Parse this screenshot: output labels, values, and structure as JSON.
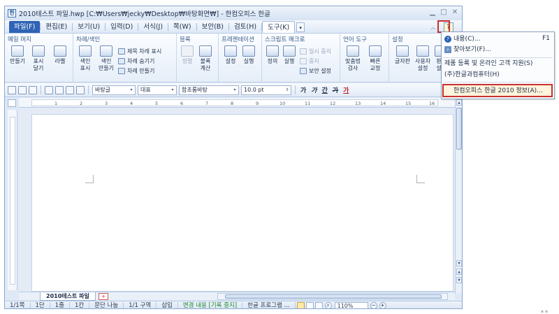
{
  "window": {
    "title": "2010테스트 파일.hwp [C:₩Users₩jecky₩Desktop₩바탕화면₩] - 한컴오피스 한글",
    "icon_label": "한"
  },
  "menus": [
    {
      "label": "파일(F)"
    },
    {
      "label": "편집(E)"
    },
    {
      "label": "보기(U)"
    },
    {
      "label": "입력(D)"
    },
    {
      "label": "서식(J)"
    },
    {
      "label": "쪽(W)"
    },
    {
      "label": "보안(B)"
    },
    {
      "label": "검토(H)"
    },
    {
      "label": "도구(K)"
    }
  ],
  "help_button": "?",
  "ribbon": {
    "groups": {
      "mail_merge": "메일 머지",
      "toc": "차례/색인",
      "block": "블록",
      "presentation": "프레젠테이션",
      "script": "스크립트 매크로",
      "language": "언어 도구",
      "settings": "설정"
    },
    "buttons": {
      "merge_make_1": "만들기",
      "merge_show_1": "표시",
      "merge_show_2": "달기",
      "label": "라벨",
      "index_show_1": "색인",
      "index_show_2": "표시",
      "index_make_1": "색인",
      "index_make_2": "만들기",
      "toc_title": "제목 차례 표시",
      "toc_hide": "차례 숨기기",
      "toc_make": "차례 만들기",
      "sort": "정렬",
      "block_calc_1": "블록",
      "block_calc_2": "계산",
      "pres_settings": "설정",
      "pres_run": "실행",
      "script_define": "정의",
      "script_run": "실행",
      "pause": "일시 중지",
      "stop": "중지",
      "security_settings": "보안 설정",
      "spell_1": "맞춤법",
      "spell_2": "검사",
      "quick_1": "빠른",
      "quick_2": "교정",
      "glyph": "글자판",
      "user_1": "사용자",
      "user_2": "설정",
      "env_1": "환",
      "env_2": "설"
    }
  },
  "format_bar": {
    "style": "바탕글",
    "lang": "대표",
    "font": "함초롬바탕",
    "size": "10.0",
    "unit": "pt",
    "bold": "가",
    "italic": "가",
    "underline": "간",
    "strike": "가",
    "color": "가"
  },
  "ruler_numbers": [
    "1",
    "2",
    "3",
    "4",
    "5",
    "6",
    "7",
    "8",
    "9",
    "10",
    "11",
    "12",
    "13",
    "14",
    "15",
    "16"
  ],
  "doc_tab": "2010테스트 파일",
  "status": {
    "page": "1/1쪽",
    "column": "1단",
    "line": "1줄",
    "col": "1칸",
    "split": "문단 나눔",
    "section": "1/1 구역",
    "insert": "삽입",
    "track": "변경 내용 [기록 중지]",
    "program": "한글 프로그램 ...",
    "zoom": "110%"
  },
  "help_menu": {
    "contents": "내용(C)...",
    "contents_shortcut": "F1",
    "search": "찾아보기(F)...",
    "register": "제품 등록 및 온라인 고객 지원(S)",
    "company": "(주)한글과컴퓨터(H)",
    "about": "한컴오피스 한글 2010 정보(A)..."
  }
}
